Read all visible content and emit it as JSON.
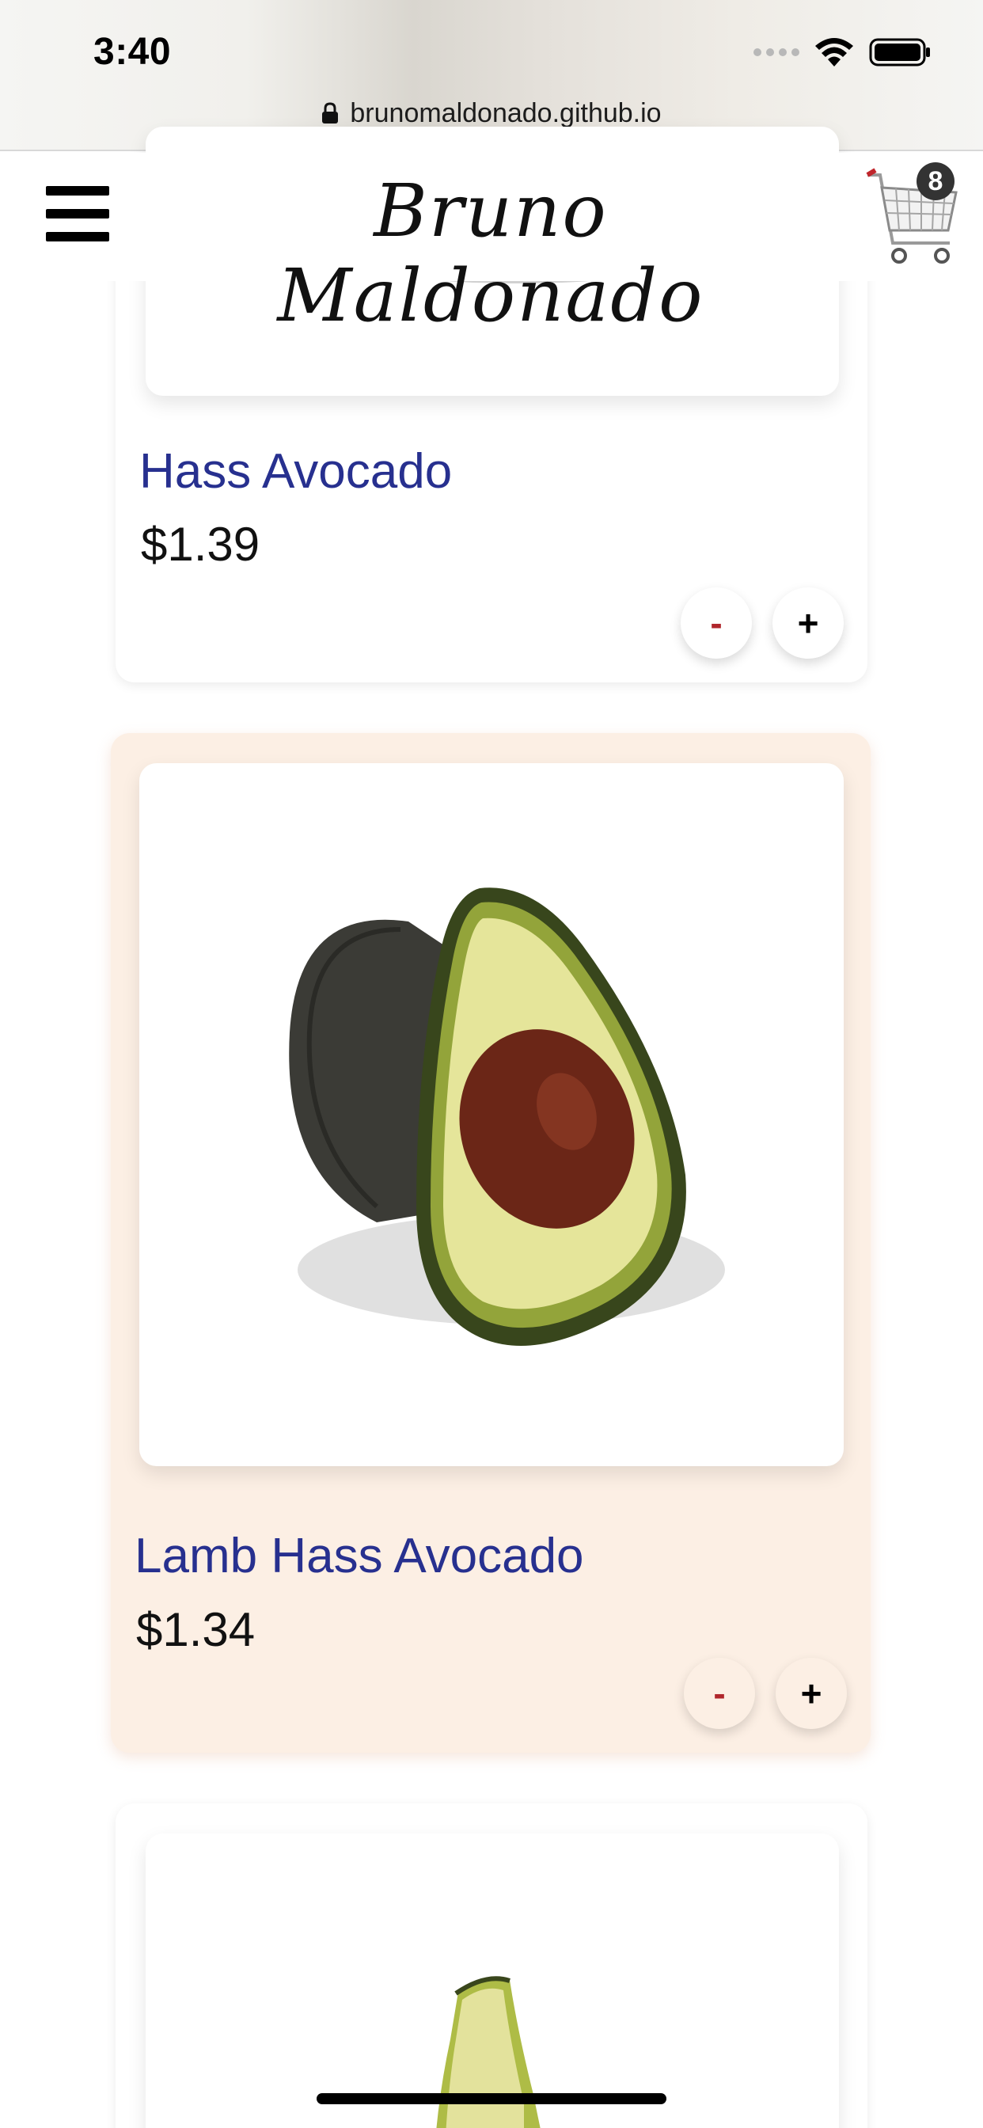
{
  "status_bar": {
    "time": "3:40"
  },
  "browser": {
    "url": "brunomaldonado.github.io"
  },
  "header": {
    "brand": "Bruno Maldonado",
    "cart_count": "8"
  },
  "products": [
    {
      "name": "Hass Avocado",
      "price": "$1.39",
      "minus_label": "-",
      "plus_label": "+"
    },
    {
      "name": "Lamb Hass Avocado",
      "price": "$1.34",
      "minus_label": "-",
      "plus_label": "+"
    }
  ],
  "colors": {
    "product_name": "#27308f",
    "minus": "#b0262c",
    "active_card": "#fcefe4"
  },
  "icons": [
    "lock-icon",
    "wifi-icon",
    "battery-icon",
    "menu-icon",
    "cart-icon"
  ]
}
